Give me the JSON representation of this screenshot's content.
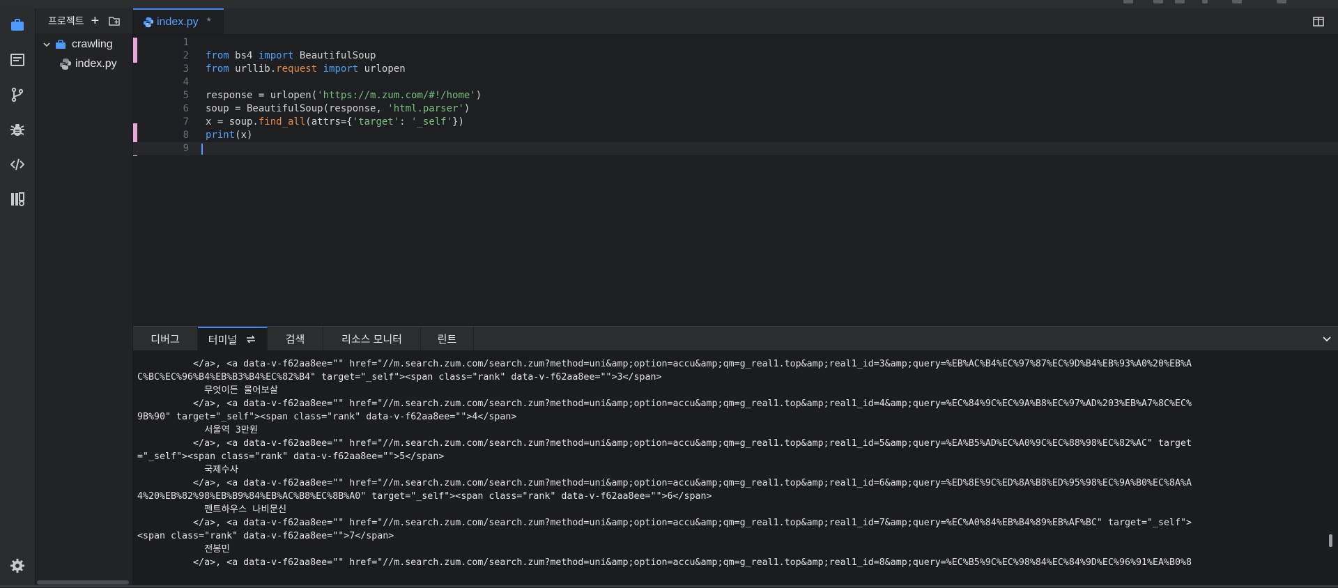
{
  "colors": {
    "accent": "#3e8cf0",
    "keyword": "#4ca0f5",
    "function": "#e6883c",
    "string": "#79c07a"
  },
  "activity_bar": [
    {
      "name": "projects-icon",
      "active": true
    },
    {
      "name": "editor-icon"
    },
    {
      "name": "source-control-icon"
    },
    {
      "name": "debug-bug-icon"
    },
    {
      "name": "code-icon"
    },
    {
      "name": "library-icon"
    },
    {
      "name": "settings-gear-icon"
    }
  ],
  "explorer": {
    "title": "프로젝트",
    "add_label": "+",
    "folder": "crawling",
    "file": "index.py"
  },
  "editor": {
    "tab_label": "index.py",
    "tab_modified": "*",
    "lines": [
      {
        "num": "1",
        "tokens": []
      },
      {
        "num": "2",
        "tokens": [
          {
            "t": "from",
            "c": "kw"
          },
          {
            "t": " bs4 "
          },
          {
            "t": "import",
            "c": "kw"
          },
          {
            "t": " BeautifulSoup"
          }
        ]
      },
      {
        "num": "3",
        "tokens": [
          {
            "t": "from",
            "c": "kw"
          },
          {
            "t": " urllib."
          },
          {
            "t": "request",
            "c": "fn"
          },
          {
            "t": " "
          },
          {
            "t": "import",
            "c": "kw"
          },
          {
            "t": " urlopen"
          }
        ]
      },
      {
        "num": "4",
        "tokens": []
      },
      {
        "num": "5",
        "tokens": [
          {
            "t": "response = urlopen("
          },
          {
            "t": "'https://m.zum.com/#!/home'",
            "c": "str"
          },
          {
            "t": ")"
          }
        ]
      },
      {
        "num": "6",
        "tokens": [
          {
            "t": "soup = BeautifulSoup(response, "
          },
          {
            "t": "'html.parser'",
            "c": "str"
          },
          {
            "t": ")"
          }
        ]
      },
      {
        "num": "7",
        "tokens": [
          {
            "t": "x = soup."
          },
          {
            "t": "find_all",
            "c": "fn"
          },
          {
            "t": "(attrs={"
          },
          {
            "t": "'target'",
            "c": "str"
          },
          {
            "t": ": "
          },
          {
            "t": "'_self'",
            "c": "str"
          },
          {
            "t": "})"
          }
        ]
      },
      {
        "num": "8",
        "tokens": [
          {
            "t": "print",
            "c": "kw"
          },
          {
            "t": "(x)"
          }
        ]
      },
      {
        "num": "9",
        "tokens": [],
        "current": true
      }
    ]
  },
  "panel": {
    "tabs": [
      "디버그",
      "터미널",
      "검색",
      "리소스 모니터",
      "린트"
    ],
    "active_tab": "터미널",
    "terminal_lines": [
      "          </a>, <a data-v-f62aa8ee=\"\" href=\"//m.search.zum.com/search.zum?method=uni&amp;option=accu&amp;qm=g_real1.top&amp;real1_id=3&amp;query=%EB%AC%B4%EC%97%87%EC%9D%B4%EB%93%A0%20%EB%A",
      "C%BC%EC%96%B4%EB%B3%B4%EC%82%B4\" target=\"_self\"><span class=\"rank\" data-v-f62aa8ee=\"\">3</span>",
      "            무엇이든 물어보살",
      "          </a>, <a data-v-f62aa8ee=\"\" href=\"//m.search.zum.com/search.zum?method=uni&amp;option=accu&amp;qm=g_real1.top&amp;real1_id=4&amp;query=%EC%84%9C%EC%9A%B8%EC%97%AD%203%EB%A7%8C%EC%",
      "9B%90\" target=\"_self\"><span class=\"rank\" data-v-f62aa8ee=\"\">4</span>",
      "            서울역 3만원",
      "          </a>, <a data-v-f62aa8ee=\"\" href=\"//m.search.zum.com/search.zum?method=uni&amp;option=accu&amp;qm=g_real1.top&amp;real1_id=5&amp;query=%EA%B5%AD%EC%A0%9C%EC%88%98%EC%82%AC\" target",
      "=\"_self\"><span class=\"rank\" data-v-f62aa8ee=\"\">5</span>",
      "            국제수사",
      "          </a>, <a data-v-f62aa8ee=\"\" href=\"//m.search.zum.com/search.zum?method=uni&amp;option=accu&amp;qm=g_real1.top&amp;real1_id=6&amp;query=%ED%8E%9C%ED%8A%B8%ED%95%98%EC%9A%B0%EC%8A%A",
      "4%20%EB%82%98%EB%B9%84%EB%AC%B8%EC%8B%A0\" target=\"_self\"><span class=\"rank\" data-v-f62aa8ee=\"\">6</span>",
      "            펜트하우스 나비문신",
      "          </a>, <a data-v-f62aa8ee=\"\" href=\"//m.search.zum.com/search.zum?method=uni&amp;option=accu&amp;qm=g_real1.top&amp;real1_id=7&amp;query=%EC%A0%84%EB%B4%89%EB%AF%BC\" target=\"_self\">",
      "<span class=\"rank\" data-v-f62aa8ee=\"\">7</span>",
      "            전봉민",
      "          </a>, <a data-v-f62aa8ee=\"\" href=\"//m.search.zum.com/search.zum?method=uni&amp;option=accu&amp;qm=g_real1.top&amp;real1_id=8&amp;query=%EC%B5%9C%EC%98%84%EC%84%9D%EC%96%91%EA%B0%8"
    ]
  }
}
